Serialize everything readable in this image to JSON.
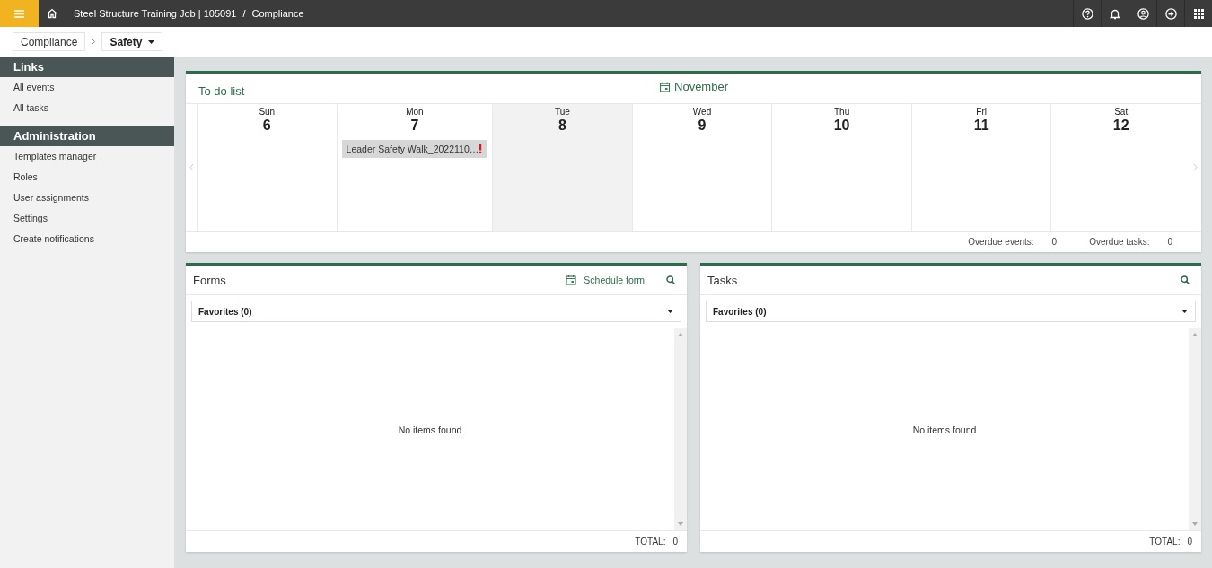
{
  "top_bar": {
    "breadcrumb": "Steel Structure Training Job | 105091",
    "separator": "/",
    "module": "Compliance"
  },
  "crumbs": {
    "parent": "Compliance",
    "current": "Safety"
  },
  "sidebar": {
    "sections": [
      {
        "title": "Links",
        "items": [
          {
            "label": "All events"
          },
          {
            "label": "All tasks"
          }
        ]
      },
      {
        "title": "Administration",
        "items": [
          {
            "label": "Templates manager"
          },
          {
            "label": "Roles"
          },
          {
            "label": "User assignments"
          },
          {
            "label": "Settings"
          },
          {
            "label": "Create notifications"
          }
        ]
      }
    ]
  },
  "todo": {
    "title": "To do list",
    "month": "November",
    "days": [
      {
        "weekday": "Sun",
        "date": "6",
        "today": false
      },
      {
        "weekday": "Mon",
        "date": "7",
        "today": false,
        "events": [
          {
            "title": "Leader Safety Walk_2022110…",
            "overdue": true
          }
        ]
      },
      {
        "weekday": "Tue",
        "date": "8",
        "today": true
      },
      {
        "weekday": "Wed",
        "date": "9",
        "today": false
      },
      {
        "weekday": "Thu",
        "date": "10",
        "today": false
      },
      {
        "weekday": "Fri",
        "date": "11",
        "today": false
      },
      {
        "weekday": "Sat",
        "date": "12",
        "today": false
      }
    ],
    "overdue_events_label": "Overdue events:",
    "overdue_events": "0",
    "overdue_tasks_label": "Overdue tasks:",
    "overdue_tasks": "0"
  },
  "panels": [
    {
      "title": "Forms",
      "action": "Schedule form",
      "filter": "Favorites (0)",
      "empty": "No items found",
      "total_label": "TOTAL:",
      "total": "0"
    },
    {
      "title": "Tasks",
      "filter": "Favorites (0)",
      "empty": "No items found",
      "total_label": "TOTAL:",
      "total": "0"
    }
  ]
}
